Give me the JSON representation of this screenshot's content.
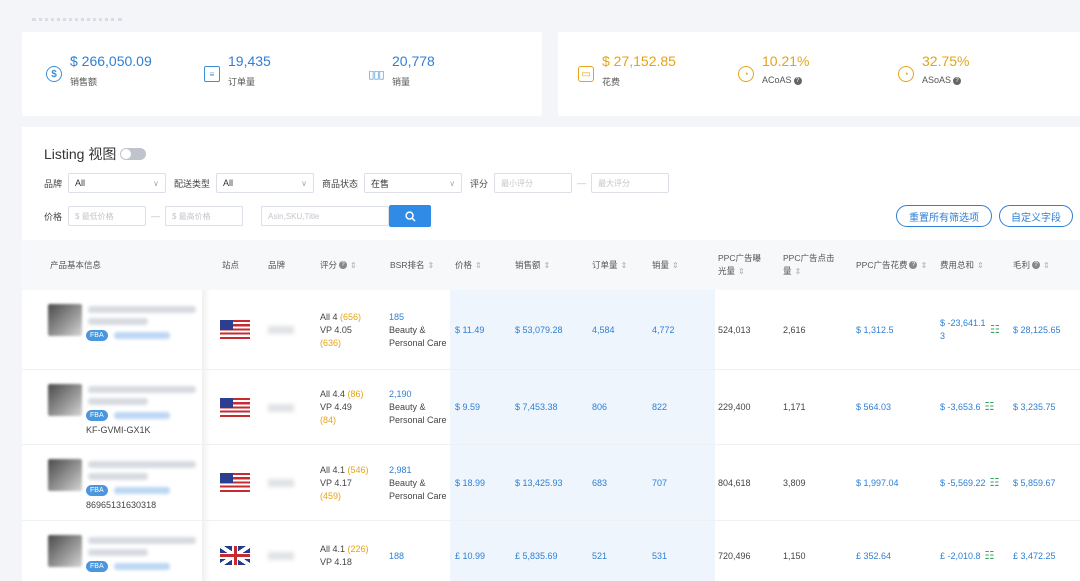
{
  "stats_left": [
    {
      "icon": "dollar-circle-icon",
      "value": "$ 266,050.09",
      "label": "销售额"
    },
    {
      "icon": "clipboard-icon",
      "value": "19,435",
      "label": "订单量"
    },
    {
      "icon": "bar-chart-icon",
      "value": "20,778",
      "label": "销量"
    }
  ],
  "stats_right": [
    {
      "icon": "wallet-icon",
      "value": "$ 27,152.85",
      "label": "花费"
    },
    {
      "icon": "pie-chart-icon",
      "value": "10.21%",
      "label": "ACoAS"
    },
    {
      "icon": "pie-chart-icon",
      "value": "32.75%",
      "label": "ASoAS"
    }
  ],
  "listing": {
    "title": "Listing 视图"
  },
  "filters": {
    "brand_label": "品牌",
    "brand_value": "All",
    "delivery_label": "配送类型",
    "delivery_value": "All",
    "status_label": "商品状态",
    "status_value": "在售",
    "rating_label": "评分",
    "rating_min_ph": "最小评分",
    "rating_max_ph": "最大评分",
    "price_label": "价格",
    "price_min_ph": "$  最低价格",
    "price_max_ph": "$  最高价格",
    "search_ph": "Asin,SKU,Title",
    "reset_label": "重置所有筛选项",
    "custom_label": "自定义字段"
  },
  "columns": {
    "product": "产品基本信息",
    "site": "站点",
    "brand": "品牌",
    "rating": "评分",
    "bsr": "BSR排名",
    "price": "价格",
    "sales": "销售额",
    "orders": "订单量",
    "units": "销量",
    "impr": "PPC广告曝光量",
    "clicks": "PPC广告点击量",
    "spend": "PPC广告花费",
    "fees": "费用总和",
    "profit": "毛利"
  },
  "rows": [
    {
      "sku": "",
      "site": "us",
      "rating_a": "All 4 ",
      "rating_a_n": "(656)",
      "rating_b": "VP 4.05",
      "rating_b_n": "(636)",
      "bsr_rank": "185",
      "bsr_cat": "Beauty & Personal Care",
      "price": "$ 11.49",
      "sales": "$ 53,079.28",
      "orders": "4,584",
      "units": "4,772",
      "impr": "524,013",
      "clicks": "2,616",
      "spend": "$ 1,312.5",
      "fees": "$ -23,641.13",
      "profit": "$ 28,125.65"
    },
    {
      "sku": "KF-GVMI-GX1K",
      "site": "us",
      "rating_a": "All 4.4 ",
      "rating_a_n": "(86)",
      "rating_b": "VP 4.49 ",
      "rating_b_n": "(84)",
      "bsr_rank": "2,190",
      "bsr_cat": "Beauty & Personal Care",
      "price": "$ 9.59",
      "sales": "$ 7,453.38",
      "orders": "806",
      "units": "822",
      "impr": "229,400",
      "clicks": "1,171",
      "spend": "$ 564.03",
      "fees": "$ -3,653.6",
      "profit": "$ 3,235.75"
    },
    {
      "sku": "86965131630318",
      "site": "us",
      "rating_a": "All 4.1 ",
      "rating_a_n": "(546)",
      "rating_b": "VP 4.17",
      "rating_b_n": "(459)",
      "bsr_rank": "2,981",
      "bsr_cat": "Beauty & Personal Care",
      "price": "$ 18.99",
      "sales": "$ 13,425.93",
      "orders": "683",
      "units": "707",
      "impr": "804,618",
      "clicks": "3,809",
      "spend": "$ 1,997.04",
      "fees": "$ -5,569.22",
      "profit": "$ 5,859.67"
    },
    {
      "sku": "",
      "site": "uk",
      "rating_a": "All 4.1 ",
      "rating_a_n": "(226)",
      "rating_b": "VP 4.18",
      "rating_b_n": "",
      "bsr_rank": "188",
      "bsr_cat": "",
      "price": "£ 10.99",
      "sales": "£ 5,835.69",
      "orders": "521",
      "units": "531",
      "impr": "720,496",
      "clicks": "1,150",
      "spend": "£ 352.64",
      "fees": "£ -2,010.8",
      "profit": "£ 3,472.25"
    }
  ]
}
